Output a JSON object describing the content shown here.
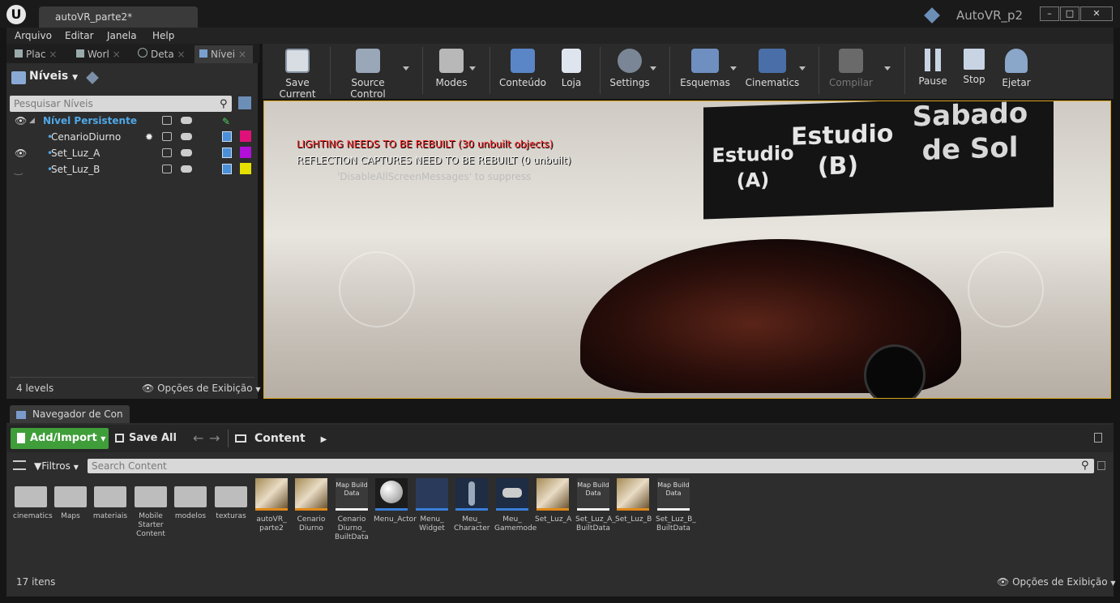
{
  "window": {
    "doc_tab": "autoVR_parte2*",
    "project_name": "AutoVR_p2",
    "buttons": {
      "minimize": "–",
      "maximize": "□",
      "close": "✕"
    }
  },
  "menu": [
    "Arquivo",
    "Editar",
    "Janela",
    "Help"
  ],
  "left_tabs": [
    {
      "label": "Plac",
      "icon": "place-icon"
    },
    {
      "label": "Worl",
      "icon": "world-icon"
    },
    {
      "label": "Deta",
      "icon": "details-icon"
    },
    {
      "label": "Nívei",
      "icon": "levels-icon"
    }
  ],
  "levels_panel": {
    "title": "Níveis",
    "search_placeholder": "Pesquisar Níveis",
    "rows": [
      {
        "name": "Nível Persistente",
        "color": ""
      },
      {
        "name": "CenarioDiurno",
        "color": "#e0127a"
      },
      {
        "name": "Set_Luz_A",
        "color": "#b20fd8"
      },
      {
        "name": "Set_Luz_B",
        "color": "#e6e000"
      }
    ],
    "count": "4 levels",
    "view_options": "Opções de Exibição"
  },
  "toolbar": [
    {
      "label": "Save Current",
      "icon": "save-icon"
    },
    {
      "label": "Source Control",
      "icon": "source-control-icon"
    },
    {
      "label": "Modes",
      "icon": "modes-icon"
    },
    {
      "label": "Conteúdo",
      "icon": "content-icon"
    },
    {
      "label": "Loja",
      "icon": "marketplace-icon"
    },
    {
      "label": "Settings",
      "icon": "settings-icon"
    },
    {
      "label": "Esquemas",
      "icon": "blueprints-icon"
    },
    {
      "label": "Cinematics",
      "icon": "cinematics-icon"
    },
    {
      "label": "Compilar",
      "icon": "build-icon"
    },
    {
      "label": "Pause",
      "icon": "pause-icon"
    },
    {
      "label": "Stop",
      "icon": "stop-icon"
    },
    {
      "label": "Ejetar",
      "icon": "eject-icon"
    }
  ],
  "viewport": {
    "msg_lighting": "LIGHTING NEEDS TO BE REBUILT (30 unbuilt objects)",
    "msg_reflection": "REFLECTION CAPTURES NEED TO BE REBUILT (0 unbuilt)",
    "msg_suppress": "'DisableAllScreenMessages' to suppress",
    "sign": [
      "Estudio",
      "(A)",
      "Estudio",
      "(B)",
      "Sabado",
      "de Sol"
    ]
  },
  "content_browser": {
    "tab": "Navegador de Con",
    "add_import": "Add/Import",
    "save_all": "Save All",
    "path": "Content",
    "filters": "Filtros",
    "search_placeholder": "Search Content",
    "items_count": "17 itens",
    "view_options": "Opções de Exibição",
    "assets": [
      {
        "label": "cinematics",
        "kind": "folder"
      },
      {
        "label": "Maps",
        "kind": "folder"
      },
      {
        "label": "materiais",
        "kind": "folder"
      },
      {
        "label": "Mobile Starter Content",
        "kind": "folder"
      },
      {
        "label": "modelos",
        "kind": "folder"
      },
      {
        "label": "texturas",
        "kind": "folder"
      },
      {
        "label": "autoVR_ parte2",
        "kind": "level"
      },
      {
        "label": "Cenario Diurno",
        "kind": "level"
      },
      {
        "label": "Cenario Diurno_ BuiltData",
        "kind": "mapbuild",
        "thumb": "Map Build Data"
      },
      {
        "label": "Menu_Actor",
        "kind": "blueprint"
      },
      {
        "label": "Menu_ Widget",
        "kind": "blueprint"
      },
      {
        "label": "Meu_ Character",
        "kind": "blueprint"
      },
      {
        "label": "Meu_ Gamemode",
        "kind": "blueprint"
      },
      {
        "label": "Set_Luz_A",
        "kind": "level"
      },
      {
        "label": "Set_Luz_A_ BuiltData",
        "kind": "mapbuild",
        "thumb": "Map Build Data"
      },
      {
        "label": "Set_Luz_B",
        "kind": "level"
      },
      {
        "label": "Set_Luz_B_ BuiltData",
        "kind": "mapbuild",
        "thumb": "Map Build Data"
      }
    ]
  }
}
